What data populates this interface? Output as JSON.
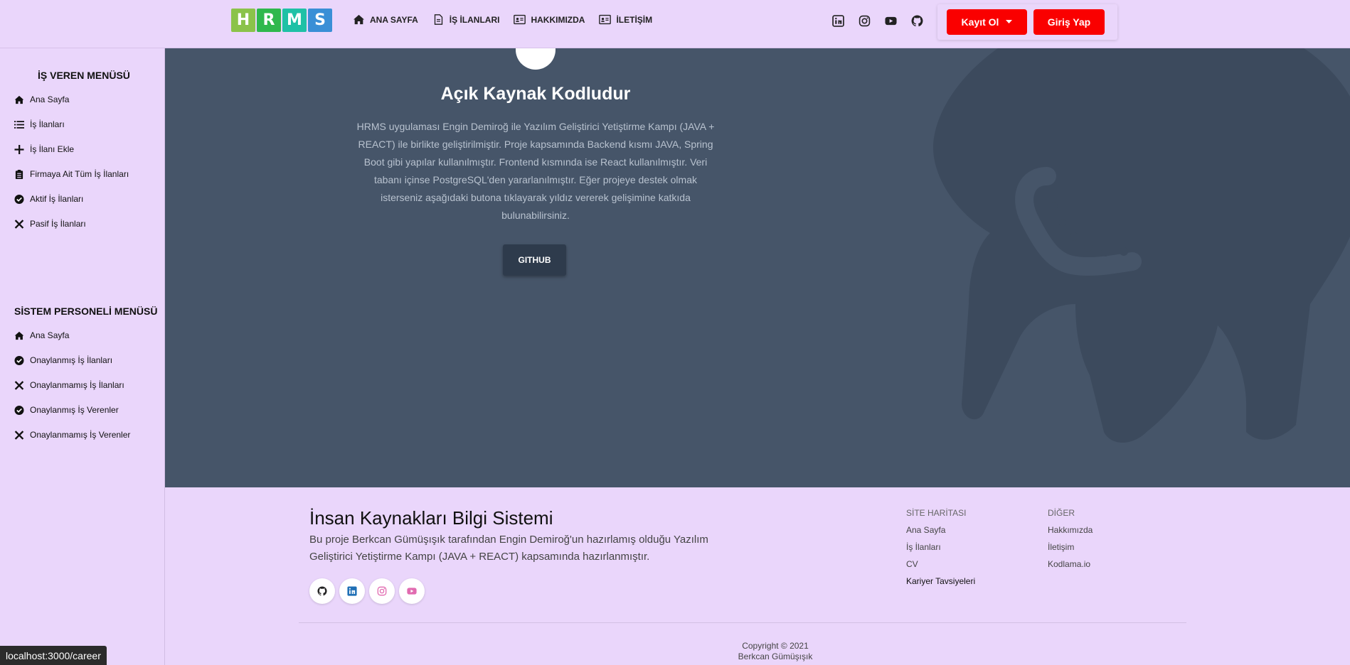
{
  "logo": {
    "letters": [
      "H",
      "R",
      "M",
      "S"
    ],
    "colors": [
      "#8bc34a",
      "#2fb84d",
      "#1fc1a6",
      "#3a8fd6"
    ]
  },
  "nav": {
    "items": [
      {
        "label": "ANA SAYFA",
        "icon": "home-icon"
      },
      {
        "label": "İŞ İLANLARI",
        "icon": "document-icon"
      },
      {
        "label": "HAKKIMIZDA",
        "icon": "id-card-icon"
      },
      {
        "label": "İLETİŞİM",
        "icon": "id-card-icon"
      }
    ],
    "social": [
      "linkedin-icon",
      "instagram-icon",
      "youtube-icon",
      "github-icon"
    ],
    "register_label": "Kayıt Ol",
    "login_label": "Giriş Yap"
  },
  "sidebar": {
    "employer_title": "İŞ VEREN MENÜSÜ",
    "employer_items": [
      {
        "label": "Ana Sayfa",
        "icon": "home-icon"
      },
      {
        "label": "İş İlanları",
        "icon": "list-icon"
      },
      {
        "label": "İş İlanı Ekle",
        "icon": "plus-icon"
      },
      {
        "label": "Firmaya Ait Tüm İş İlanları",
        "icon": "clipboard-icon"
      },
      {
        "label": "Aktif İş İlanları",
        "icon": "check-circle-icon"
      },
      {
        "label": "Pasif İş İlanları",
        "icon": "close-icon"
      }
    ],
    "staff_title": "SİSTEM PERSONELİ MENÜSÜ",
    "staff_items": [
      {
        "label": "Ana Sayfa",
        "icon": "home-icon"
      },
      {
        "label": "Onaylanmış İş İlanları",
        "icon": "check-circle-icon"
      },
      {
        "label": "Onaylanmamış İş İlanları",
        "icon": "close-icon"
      },
      {
        "label": "Onaylanmış İş Verenler",
        "icon": "check-circle-icon"
      },
      {
        "label": "Onaylanmamış İş Verenler",
        "icon": "close-icon"
      }
    ]
  },
  "hero": {
    "title": "Açık Kaynak Kodludur",
    "text": "HRMS uygulaması Engin Demiroğ ile Yazılım Geliştirici Yetiştirme Kampı (JAVA + REACT) ile birlikte geliştirilmiştir. Proje kapsamında Backend kısmı JAVA, Spring Boot gibi yapılar kullanılmıştır. Frontend kısmında ise React kullanılmıştır. Veri tabanı içinse PostgreSQL'den yararlanılmıştır. Eğer projeye destek olmak isterseniz aşağıdaki butona tıklayarak yıldız vererek gelişimine katkıda bulunabilirsiniz.",
    "button_label": "GITHUB"
  },
  "footer": {
    "title": "İnsan Kaynakları Bilgi Sistemi",
    "description": "Bu proje Berkcan Gümüşışık tarafından Engin Demiroğ'un hazırlamış olduğu Yazılım Geliştirici Yetiştirme Kampı (JAVA + REACT) kapsamında hazırlanmıştır.",
    "social": [
      "github-icon",
      "linkedin-icon",
      "instagram-icon",
      "youtube-icon"
    ],
    "sitemap_title": "SİTE HARİTASI",
    "sitemap_links": [
      "Ana Sayfa",
      "İş İlanları",
      "CV",
      "Kariyer Tavsiyeleri"
    ],
    "other_title": "DİĞER",
    "other_links": [
      "Hakkımızda",
      "İletişim",
      "Kodlama.io"
    ],
    "copyright_line1": "Copyright © 2021",
    "copyright_line2": "Berkcan Gümüşışık"
  },
  "status_url": "localhost:3000/career"
}
